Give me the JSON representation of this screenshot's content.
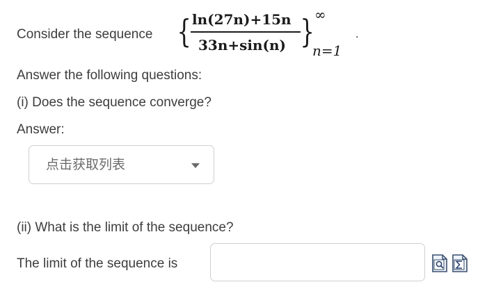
{
  "question": {
    "intro": "Consider the sequence",
    "formula": {
      "numerator": "ln(27n)+15n",
      "denominator": "33n+sin(n)",
      "upper_limit": "∞",
      "lower_limit": "n=1",
      "trailing_punct": "."
    },
    "instruction": "Answer the following questions:",
    "part1": {
      "question": "(i) Does the sequence converge?",
      "answer_label": "Answer:",
      "dropdown_placeholder": "点击获取列表"
    },
    "part2": {
      "question": "(ii) What is the limit of the sequence?",
      "answer_label": "The limit of the sequence is",
      "input_value": ""
    }
  },
  "icons": {
    "preview": "preview-icon",
    "equation_editor": "sigma-icon"
  }
}
